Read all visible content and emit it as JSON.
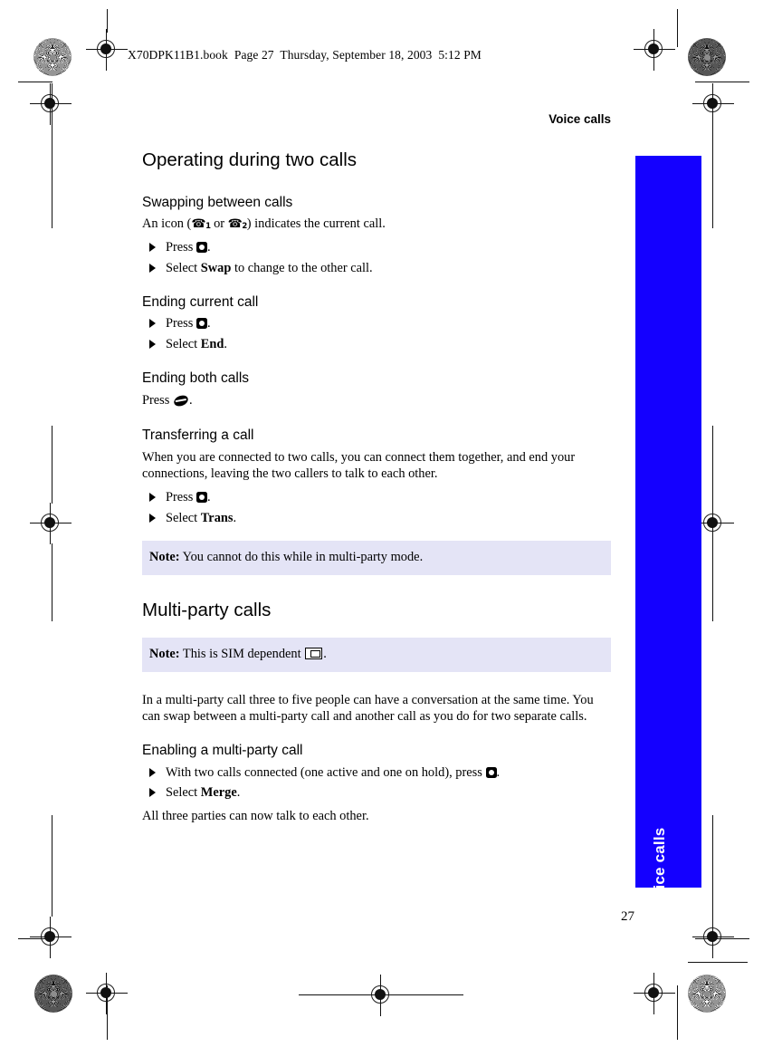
{
  "book_header": "X70DPK11B1.book  Page 27  Thursday, September 18, 2003  5:12 PM",
  "running_head": "Voice calls",
  "side_tab": {
    "label": "Voice calls",
    "color": "#1400ff",
    "text_color": "#ffffff"
  },
  "page_number": "27",
  "note_bg_color": "#e4e4f6",
  "sections": [
    {
      "id": "operating-during-two-calls",
      "heading": "Operating during two calls",
      "subsections": [
        {
          "id": "swapping-between-calls",
          "heading": "Swapping between calls",
          "intro_before_icons": "An icon (",
          "icon_1": "1",
          "intro_between_icons": " or ",
          "icon_2": "2",
          "intro_after_icons": ") indicates the current call.",
          "steps": [
            {
              "lead": "Press",
              "icon": "ok-key",
              "tail": "."
            },
            {
              "lead": "Select",
              "strong": "Swap",
              "tail": " to change to the other call."
            }
          ]
        },
        {
          "id": "ending-current-call",
          "heading": "Ending current call",
          "steps": [
            {
              "lead": "Press",
              "icon": "ok-key",
              "tail": "."
            },
            {
              "lead": "Select",
              "strong": "End",
              "tail": "."
            }
          ]
        },
        {
          "id": "ending-both-calls",
          "heading": "Ending both calls",
          "body_lead": "Press",
          "body_icon": "end-key",
          "body_tail": "."
        },
        {
          "id": "transferring-a-call",
          "heading": "Transferring a call",
          "paragraph": "When you are connected to two calls, you can connect them together, and end your connections, leaving the two callers to talk to each other.",
          "steps": [
            {
              "lead": "Press",
              "icon": "ok-key",
              "tail": "."
            },
            {
              "lead": "Select",
              "strong": "Trans",
              "tail": "."
            }
          ],
          "note_label": "Note:",
          "note_text": " You cannot do this while in multi-party mode."
        }
      ]
    },
    {
      "id": "multi-party-calls",
      "heading": "Multi-party calls",
      "note_label": "Note:",
      "note_text": " This is SIM dependent ",
      "note_icon": "sim-card",
      "note_tail": ".",
      "paragraph": "In a multi-party call three to five people can have a conversation at the same time. You can swap between a multi-party call and another call as you do for two separate calls.",
      "subsections": [
        {
          "id": "enabling-a-multi-party-call",
          "heading": "Enabling a multi-party call",
          "steps": [
            {
              "lead": "With two calls connected (one active and one on hold), press",
              "icon": "ok-key",
              "tail": "."
            },
            {
              "lead": "Select",
              "strong": "Merge",
              "tail": "."
            }
          ],
          "closing": "All three parties can now talk to each other."
        }
      ]
    }
  ]
}
